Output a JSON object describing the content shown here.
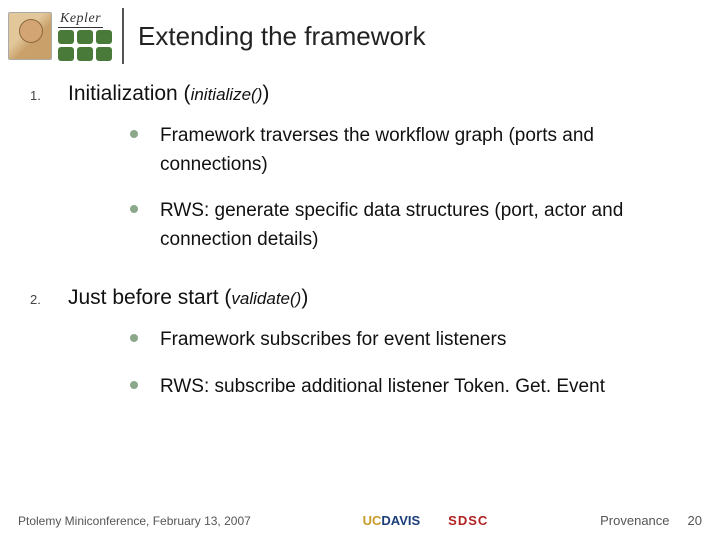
{
  "header": {
    "logo_text": "Kepler",
    "title": "Extending the framework"
  },
  "items": [
    {
      "number": "1.",
      "heading_prefix": "Initialization (",
      "heading_code": "initialize()",
      "heading_suffix": ")",
      "bullets": [
        "Framework traverses the workflow graph (ports and connections)",
        "RWS: generate specific data structures (port, actor and connection details)"
      ]
    },
    {
      "number": "2.",
      "heading_prefix": "Just before start (",
      "heading_code": "validate()",
      "heading_suffix": ")",
      "bullets": [
        "Framework subscribes for event listeners",
        "RWS: subscribe additional listener Token. Get. Event"
      ]
    }
  ],
  "footer": {
    "left": "Ptolemy Miniconference, February 13, 2007",
    "ucdavis_prefix": "UC",
    "ucdavis_suffix": "DAVIS",
    "sdsc": "SDSC",
    "right_label": "Provenance",
    "page": "20"
  }
}
